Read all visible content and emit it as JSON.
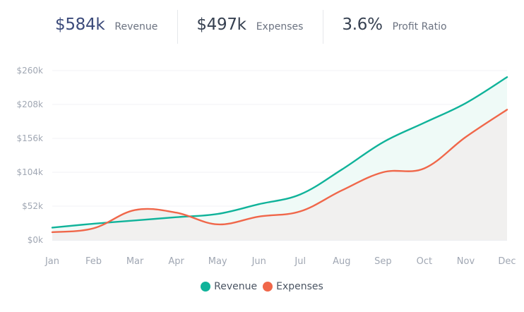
{
  "stats": [
    {
      "value": "$584k",
      "label": "Revenue",
      "value_color": "#3b4a7a"
    },
    {
      "value": "$497k",
      "label": "Expenses",
      "value_color": "#374151"
    },
    {
      "value": "3.6%",
      "label": "Profit Ratio",
      "value_color": "#374151"
    }
  ],
  "chart_data": {
    "type": "area",
    "categories": [
      "Jan",
      "Feb",
      "Mar",
      "Apr",
      "May",
      "Jun",
      "Jul",
      "Aug",
      "Sep",
      "Oct",
      "Nov",
      "Dec"
    ],
    "series": [
      {
        "name": "Revenue",
        "color": "#10b39a",
        "values": [
          19,
          25,
          30,
          35,
          40,
          55,
          70,
          108,
          150,
          180,
          210,
          250
        ]
      },
      {
        "name": "Expenses",
        "color": "#f0674a",
        "values": [
          12,
          18,
          46,
          42,
          24,
          36,
          44,
          76,
          104,
          110,
          158,
          200
        ]
      }
    ],
    "y_ticks": [
      "$0k",
      "$52k",
      "$104k",
      "$156k",
      "$208k",
      "$260k"
    ],
    "ylim": [
      0,
      260
    ],
    "grid": true,
    "legend": "bottom-center"
  }
}
